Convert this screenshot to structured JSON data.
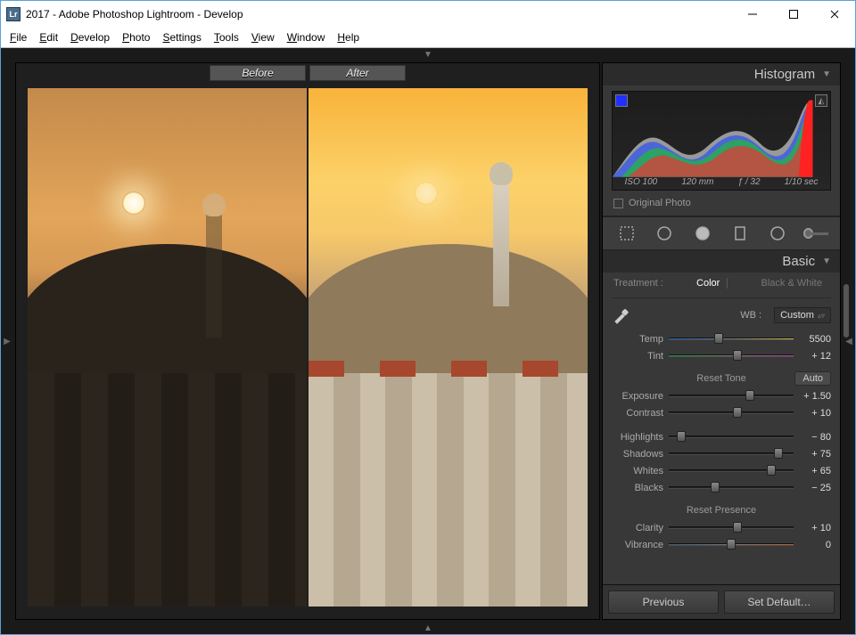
{
  "window": {
    "app_icon_text": "Lr",
    "title": "2017 - Adobe Photoshop Lightroom - Develop"
  },
  "menu": {
    "file": "File",
    "edit": "Edit",
    "develop": "Develop",
    "photo": "Photo",
    "settings": "Settings",
    "tools": "Tools",
    "view": "View",
    "window": "Window",
    "help": "Help"
  },
  "preview": {
    "before": "Before",
    "after": "After"
  },
  "right": {
    "histogram_title": "Histogram",
    "exif": {
      "iso": "ISO 100",
      "focal": "120 mm",
      "aperture": "ƒ / 32",
      "shutter": "1/10 sec"
    },
    "original_photo": "Original Photo",
    "basic_title": "Basic",
    "treatment_label": "Treatment :",
    "treatment_color": "Color",
    "treatment_bw": "Black & White",
    "wb_label": "WB :",
    "wb_value": "Custom",
    "sliders": {
      "temp": {
        "label": "Temp",
        "value": "5500",
        "pos": 40
      },
      "tint": {
        "label": "Tint",
        "value": "+ 12",
        "pos": 55
      },
      "tone_header": "Reset Tone",
      "auto": "Auto",
      "exposure": {
        "label": "Exposure",
        "value": "+ 1.50",
        "pos": 65
      },
      "contrast": {
        "label": "Contrast",
        "value": "+ 10",
        "pos": 55
      },
      "highlights": {
        "label": "Highlights",
        "value": "− 80",
        "pos": 10
      },
      "shadows": {
        "label": "Shadows",
        "value": "+ 75",
        "pos": 88
      },
      "whites": {
        "label": "Whites",
        "value": "+ 65",
        "pos": 82
      },
      "blacks": {
        "label": "Blacks",
        "value": "− 25",
        "pos": 37
      },
      "presence_header": "Reset Presence",
      "clarity": {
        "label": "Clarity",
        "value": "+ 10",
        "pos": 55
      },
      "vibrance": {
        "label": "Vibrance",
        "value": "0",
        "pos": 50
      }
    },
    "footer": {
      "previous": "Previous",
      "set_default": "Set Default…"
    }
  }
}
